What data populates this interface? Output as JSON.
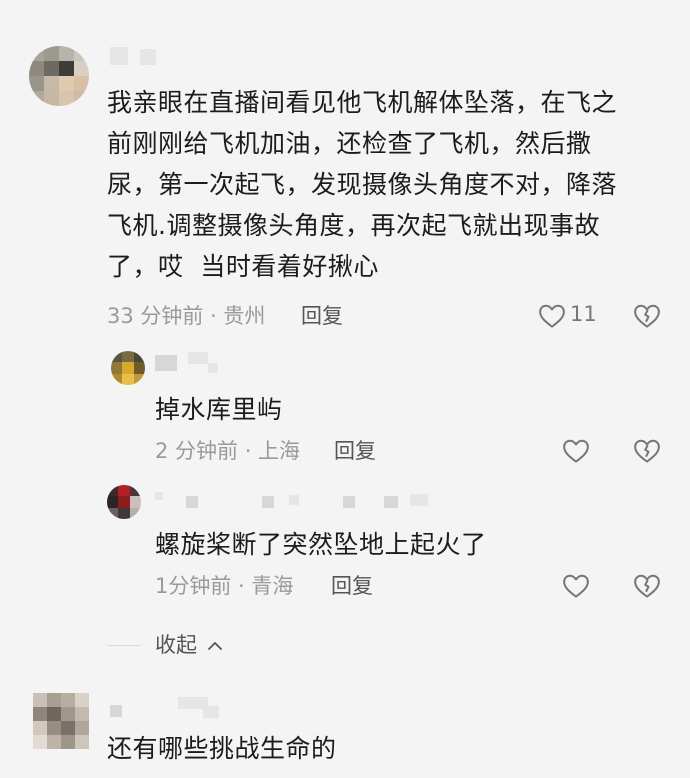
{
  "comments": [
    {
      "text": "我亲眼在直播间看见他飞机解体坠落，在飞之前刚刚给飞机加油，还检查了飞机，然后撒尿，第一次起飞，发现摄像头角度不对，降落飞机.调整摄像头角度，再次起飞就出现事故了，哎 当时看着好揪心",
      "lines": [
        "我亲眼在直播间看见他飞机解体坠落，在飞之",
        "前刚刚给飞机加油，还检查了飞机，然后撒",
        "尿，第一次起飞，发现摄像头角度不对，降落",
        "飞机.调整摄像头角度，再次起飞就出现事故",
        "了，哎  当时看着好揪心"
      ],
      "meta": "33 分钟前 · 贵州",
      "reply_label": "回复",
      "like_count": "11"
    }
  ],
  "replies": [
    {
      "text": "掉水库里屿",
      "meta": "2 分钟前 · 上海",
      "reply_label": "回复"
    },
    {
      "text": "螺旋桨断了突然坠地上起火了",
      "meta": "1分钟前 · 青海",
      "reply_label": "回复"
    }
  ],
  "collapse_label": "收起",
  "collapse_icon": "chevron-up-icon",
  "next_comment": {
    "text": "还有哪些挑战生命的"
  },
  "icons": {
    "like": "heart-icon",
    "dislike": "broken-heart-icon"
  },
  "colors": {
    "background": "#f4f4f4",
    "text": "#1c1c1c",
    "meta": "#9a9a9a"
  }
}
